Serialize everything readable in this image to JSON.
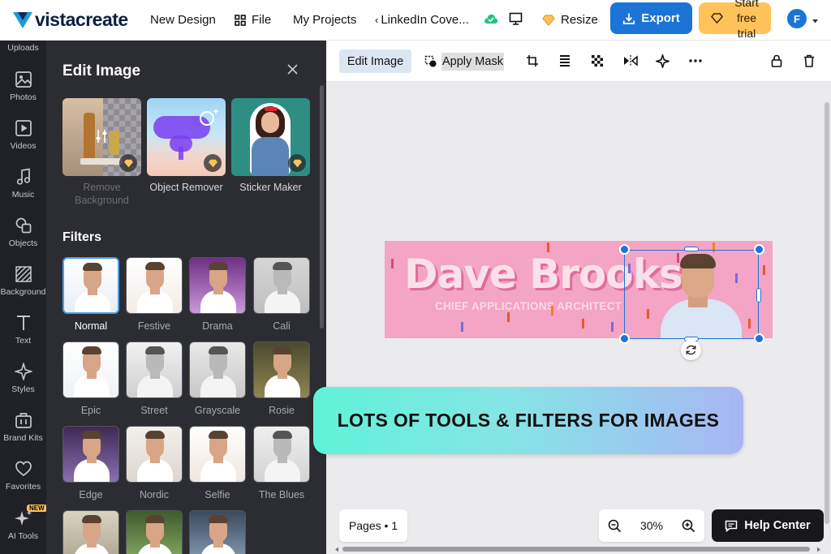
{
  "topbar": {
    "logo_text": "vistacreate",
    "new_design": "New Design",
    "file": "File",
    "my_projects": "My Projects",
    "doc_title": "LinkedIn Cove...",
    "resize": "Resize",
    "export": "Export",
    "trial": "Start free trial",
    "avatar_initial": "F"
  },
  "rail": [
    {
      "label": "Uploads",
      "icon": "upload-icon"
    },
    {
      "label": "Photos",
      "icon": "photo-icon"
    },
    {
      "label": "Videos",
      "icon": "video-icon"
    },
    {
      "label": "Music",
      "icon": "music-icon"
    },
    {
      "label": "Objects",
      "icon": "objects-icon"
    },
    {
      "label": "Background",
      "icon": "background-icon"
    },
    {
      "label": "Text",
      "icon": "text-icon"
    },
    {
      "label": "Styles",
      "icon": "styles-icon"
    },
    {
      "label": "Brand Kits",
      "icon": "brand-kit-icon"
    },
    {
      "label": "Favorites",
      "icon": "heart-icon"
    },
    {
      "label": "AI Tools",
      "icon": "sparkle-icon",
      "badge": "NEW"
    }
  ],
  "panel": {
    "title": "Edit Image",
    "tools": [
      {
        "label": "Remove Background",
        "disabled": true
      },
      {
        "label": "Object Remover",
        "disabled": false
      },
      {
        "label": "Sticker Maker",
        "disabled": false
      }
    ],
    "filters_title": "Filters",
    "filters": [
      "Normal",
      "Festive",
      "Drama",
      "Cali",
      "Epic",
      "Street",
      "Grayscale",
      "Rosie",
      "Edge",
      "Nordic",
      "Selfie",
      "The Blues",
      "",
      "",
      ""
    ],
    "selected_filter": "Normal"
  },
  "toolbar": {
    "edit_image": "Edit Image",
    "apply_mask": "Apply Mask"
  },
  "canvas": {
    "name": "Dave Brooks",
    "role": "CHIEF APPLICATIONS ARCHITECT"
  },
  "banner": "LOTS OF TOOLS & FILTERS FOR IMAGES",
  "footer": {
    "pages": "Pages • 1",
    "zoom": "30%",
    "help": "Help Center"
  },
  "colors": {
    "accent": "#1b74d6",
    "trial": "#ffc35a",
    "panel_bg": "#2c2d33",
    "canvas_pink": "#f4a4c4"
  }
}
